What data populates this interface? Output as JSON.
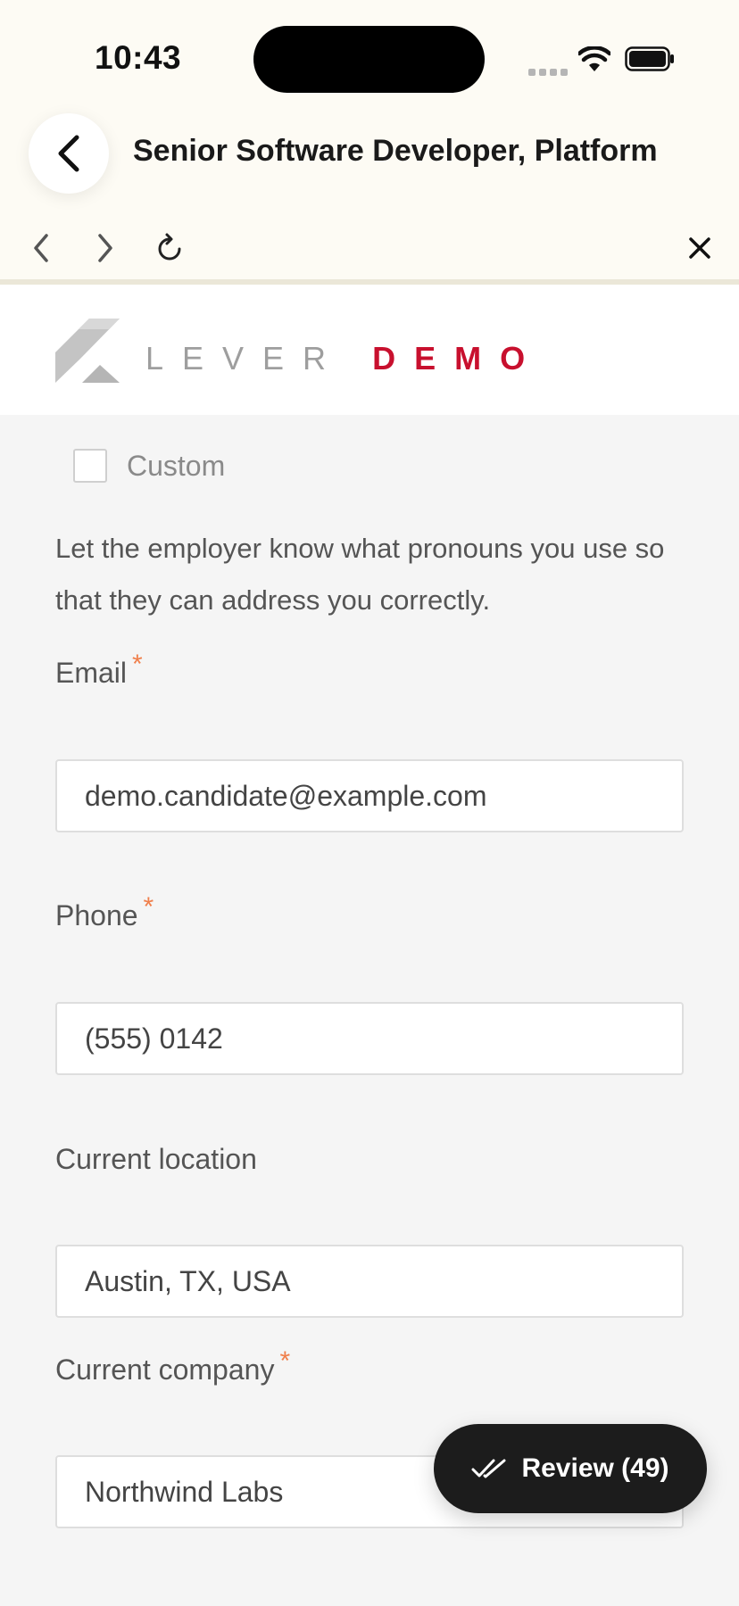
{
  "status_bar": {
    "time": "10:43"
  },
  "header": {
    "title": "Senior Software Developer, Platform"
  },
  "logo": {
    "part1": "LEVER",
    "part2": "DEMO"
  },
  "form": {
    "custom_label": "Custom",
    "custom_checked": false,
    "pronoun_help": "Let the employer know what pronouns you use so that they can address you correctly.",
    "required_mark": "*",
    "email": {
      "label": "Email",
      "value": "demo.candidate@example.com"
    },
    "phone": {
      "label": "Phone",
      "value": "(555) 0142"
    },
    "location": {
      "label": "Current location",
      "value": "Austin, TX, USA"
    },
    "company": {
      "label": "Current company",
      "value": "Northwind Labs"
    }
  },
  "review_button": {
    "label": "Review (49)"
  },
  "colors": {
    "brand_red": "#c8102e",
    "required": "#f07f4b",
    "header_bg": "#fdfbf4",
    "page_bg": "#f5f5f5"
  }
}
